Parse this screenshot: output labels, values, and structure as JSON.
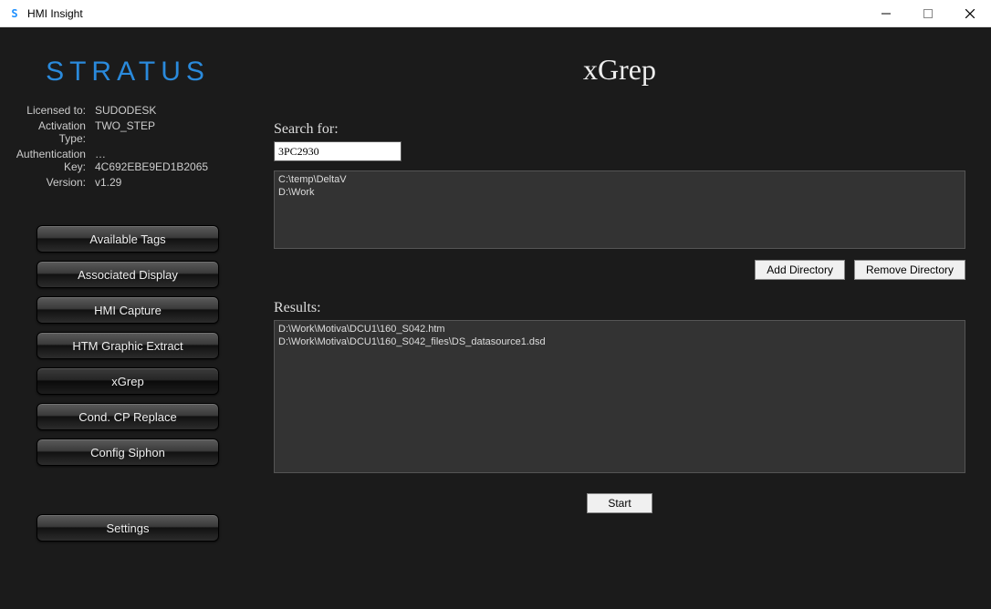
{
  "window": {
    "title": "HMI Insight"
  },
  "brand": "STRATUS",
  "license": {
    "licensed_to_label": "Licensed to:",
    "licensed_to": "SUDODESK",
    "activation_type_label": "Activation Type:",
    "activation_type": "TWO_STEP",
    "auth_key_label": "Authentication Key:",
    "auth_key": "…4C692EBE9ED1B2065",
    "version_label": "Version:",
    "version": "v1.29"
  },
  "nav": {
    "available_tags": "Available Tags",
    "associated_display": "Associated Display",
    "hmi_capture": "HMI Capture",
    "htm_graphic_extract": "HTM Graphic Extract",
    "xgrep": "xGrep",
    "cond_cp_replace": "Cond. CP Replace",
    "config_siphon": "Config Siphon",
    "settings": "Settings"
  },
  "page": {
    "title": "xGrep",
    "search_label": "Search for:",
    "search_value": "3PC2930",
    "directories": [
      "C:\\temp\\DeltaV",
      "D:\\Work"
    ],
    "add_directory": "Add Directory",
    "remove_directory": "Remove Directory",
    "results_label": "Results:",
    "results": [
      "D:\\Work\\Motiva\\DCU1\\160_S042.htm",
      "D:\\Work\\Motiva\\DCU1\\160_S042_files\\DS_datasource1.dsd"
    ],
    "start": "Start"
  }
}
